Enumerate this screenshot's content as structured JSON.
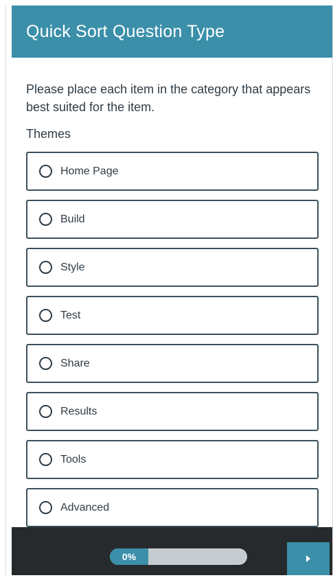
{
  "header": {
    "title": "Quick Sort Question Type"
  },
  "question": {
    "prompt": "Please place each item in the category that appears best suited for the item.",
    "group_label": "Themes",
    "options": [
      {
        "label": "Home Page"
      },
      {
        "label": "Build"
      },
      {
        "label": "Style"
      },
      {
        "label": "Test"
      },
      {
        "label": "Share"
      },
      {
        "label": "Results"
      },
      {
        "label": "Tools"
      },
      {
        "label": "Advanced"
      }
    ]
  },
  "footer": {
    "progress_text": "0%",
    "progress_value": 0,
    "next_icon": "chevron-right-icon"
  },
  "colors": {
    "accent": "#3b8fa9",
    "footer_bg": "#262a2d",
    "option_border": "#3a4f5c",
    "progress_track": "#c6cdd2"
  }
}
